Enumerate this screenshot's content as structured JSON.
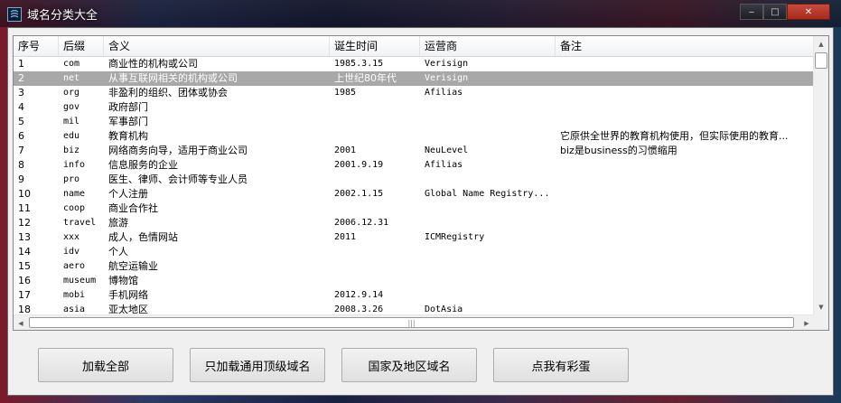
{
  "window": {
    "title": "域名分类大全",
    "min_label": "‒",
    "max_label": "□",
    "close_label": "✕"
  },
  "table": {
    "columns": [
      "序号",
      "后缀",
      "含义",
      "诞生时间",
      "运营商",
      "备注"
    ],
    "selected_row": 1,
    "rows": [
      [
        "1",
        "com",
        "商业性的机构或公司",
        "1985.3.15",
        "Verisign",
        ""
      ],
      [
        "2",
        "net",
        "从事互联网相关的机构或公司",
        "上世纪80年代",
        "Verisign",
        ""
      ],
      [
        "3",
        "org",
        "非盈利的组织、团体或协会",
        "1985",
        "Afilias",
        ""
      ],
      [
        "4",
        "gov",
        "政府部门",
        "",
        "",
        ""
      ],
      [
        "5",
        "mil",
        "军事部门",
        "",
        "",
        ""
      ],
      [
        "6",
        "edu",
        "教育机构",
        "",
        "",
        "它原供全世界的教育机构使用，但实际使用的教育..."
      ],
      [
        "7",
        "biz",
        "网络商务向导，适用于商业公司",
        "2001",
        "NeuLevel",
        "biz是business的习惯缩用"
      ],
      [
        "8",
        "info",
        "信息服务的企业",
        "2001.9.19",
        "Afilias",
        ""
      ],
      [
        "9",
        "pro",
        "医生、律师、会计师等专业人员",
        "",
        "",
        ""
      ],
      [
        "10",
        "name",
        "个人注册",
        "2002.1.15",
        "Global Name Registry...",
        ""
      ],
      [
        "11",
        "coop",
        "商业合作社",
        "",
        "",
        ""
      ],
      [
        "12",
        "travel",
        "旅游",
        "2006.12.31",
        "",
        ""
      ],
      [
        "13",
        "xxx",
        "成人，色情网站",
        "2011",
        "ICMRegistry",
        ""
      ],
      [
        "14",
        "idv",
        "个人",
        "",
        "",
        ""
      ],
      [
        "15",
        "aero",
        "航空运输业",
        "",
        "",
        ""
      ],
      [
        "16",
        "museum",
        "博物馆",
        "",
        "",
        ""
      ],
      [
        "17",
        "mobi",
        "手机网络",
        "2012.9.14",
        "",
        ""
      ],
      [
        "18",
        "asia",
        "亚太地区",
        "2008.3.26",
        "DotAsia",
        ""
      ]
    ]
  },
  "buttons": {
    "load_all": "加载全部",
    "load_generic": "只加载通用顶级域名",
    "country": "国家及地区域名",
    "easter_egg": "点我有彩蛋"
  },
  "colors": {
    "selected_row": "#a8a8a8",
    "close_button": "#c74a3a"
  }
}
